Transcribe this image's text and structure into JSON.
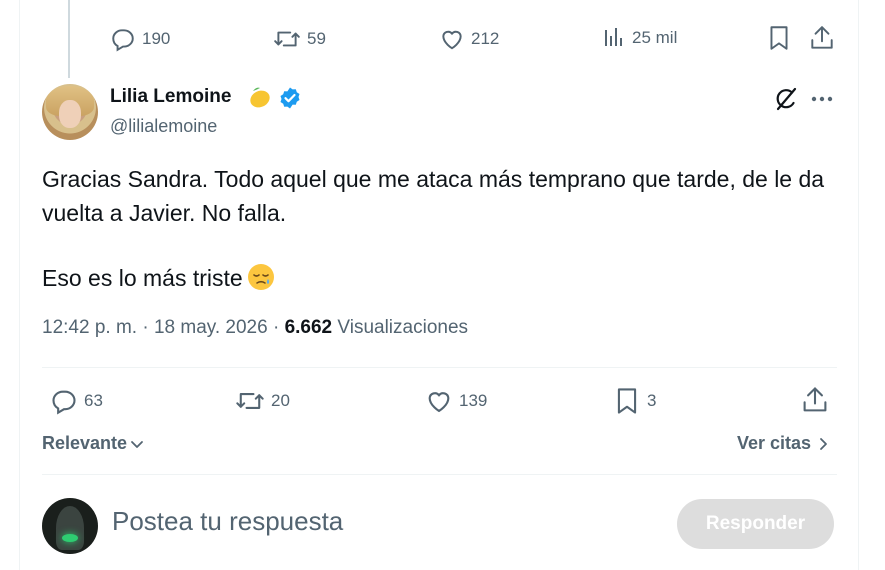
{
  "parent_tweet": {
    "actions": {
      "replies": "190",
      "retweets": "59",
      "likes": "212",
      "views": "25 mil"
    }
  },
  "tweet": {
    "author_name": "Lilia Lemoine",
    "author_handle": "@lilialemoine",
    "text_line_1": "Gracias Sandra. Todo aquel que me ataca más temprano que tarde, de le da vuelta a Javier. No falla.",
    "text_line_2": "Eso es lo más triste",
    "time": "12:42 p. m.",
    "date": "18 may. 2026",
    "views_count": "6.662",
    "views_label": "Visualizaciones",
    "actions": {
      "replies": "63",
      "retweets": "20",
      "likes": "139",
      "bookmarks": "3"
    }
  },
  "replies_bar": {
    "sort_label": "Relevante",
    "quotes_label": "Ver citas"
  },
  "composer": {
    "placeholder": "Postea tu respuesta",
    "submit_label": "Responder"
  },
  "colors": {
    "muted": "#536471",
    "text": "#0f1419",
    "verified": "#1d9bf0",
    "divider": "#eff3f4",
    "button_disabled": "#dddddd"
  }
}
